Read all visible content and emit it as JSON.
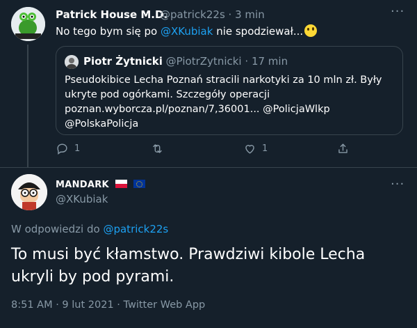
{
  "tweet1": {
    "name": "Patrick House M.D.",
    "handle": "@patrick22s",
    "separator": "·",
    "time": "3 min",
    "text_before": "No tego bym się po ",
    "mention": "@XKubiak",
    "text_after": " nie spodziewał...",
    "emoji": "zany-face-emoji",
    "quote": {
      "name": "Piotr Żytnicki",
      "handle": "@PiotrZytnicki",
      "separator": "·",
      "time": "17 min",
      "line1": "Pseudokibice Lecha Poznań stracili narkotyki za 10 mln zł. Były",
      "line2": "ukryte pod ogórkami. Szczegóły operacji",
      "line3_link": "poznan.wyborcza.pl/poznan/7,36001...",
      "line3_mention": "@PolicjaWlkp",
      "line4_mention": "@PolskaPolicja"
    },
    "actions": {
      "reply_count": "1",
      "retweet_count": "",
      "like_count": "1"
    }
  },
  "tweet2": {
    "name": "MANDARK",
    "flags": [
      "poland-flag",
      "eu-flag"
    ],
    "handle": "@XKubiak",
    "reply_label": "W odpowiedzi do ",
    "reply_mention": "@patrick22s",
    "text": "To musi być kłamstwo. Prawdziwi kibole Lecha ukryli by pod pyrami.",
    "meta": "8:51 AM · 9 lut 2021 · Twitter Web App"
  },
  "icons": {
    "more": "more-horizontal-icon",
    "reply": "reply-icon",
    "retweet": "retweet-icon",
    "like": "like-icon",
    "share": "share-icon"
  },
  "colors": {
    "background": "#15202b",
    "text": "#ffffff",
    "muted": "#8899a6",
    "link": "#1da1f2",
    "border": "#38444d"
  }
}
